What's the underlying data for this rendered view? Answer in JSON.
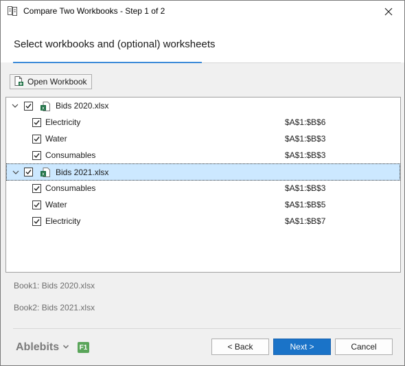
{
  "window": {
    "title": "Compare Two Workbooks - Step 1 of 2"
  },
  "header": {
    "title": "Select workbooks and (optional) worksheets"
  },
  "toolbar": {
    "open_label": "Open Workbook"
  },
  "tree": {
    "rows": [
      {
        "type": "workbook",
        "label": "Bids 2020.xlsx",
        "checked": true,
        "expanded": true,
        "selected": false
      },
      {
        "type": "sheet",
        "label": "Electricity",
        "range": "$A$1:$B$6",
        "checked": true
      },
      {
        "type": "sheet",
        "label": "Water",
        "range": "$A$1:$B$3",
        "checked": true
      },
      {
        "type": "sheet",
        "label": "Consumables",
        "range": "$A$1:$B$3",
        "checked": true
      },
      {
        "type": "workbook",
        "label": "Bids 2021.xlsx",
        "checked": true,
        "expanded": true,
        "selected": true
      },
      {
        "type": "sheet",
        "label": "Consumables",
        "range": "$A$1:$B$3",
        "checked": true
      },
      {
        "type": "sheet",
        "label": "Water",
        "range": "$A$1:$B$5",
        "checked": true
      },
      {
        "type": "sheet",
        "label": "Electricity",
        "range": "$A$1:$B$7",
        "checked": true
      }
    ]
  },
  "summary": {
    "book1": "Book1: Bids 2020.xlsx",
    "book2": "Book2: Bids 2021.xlsx"
  },
  "footer": {
    "brand": "Ablebits",
    "help": "F1",
    "back_label": "< Back",
    "next_label": "Next >",
    "cancel_label": "Cancel"
  },
  "colors": {
    "accent": "#1a73c8",
    "selection": "#cce8ff",
    "excel_green": "#1d7044",
    "help_green": "#5aa55a"
  }
}
